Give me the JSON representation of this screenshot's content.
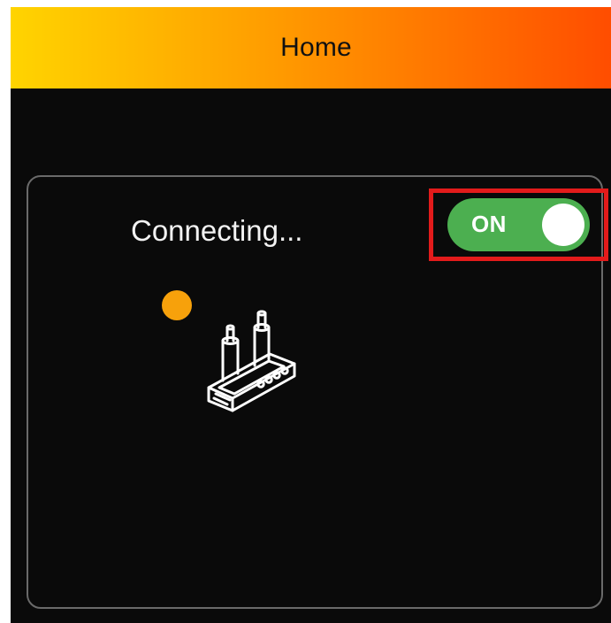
{
  "header": {
    "title": "Home",
    "gradient_start": "#ffd400",
    "gradient_end": "#ff4d00"
  },
  "card": {
    "status_text": "Connecting...",
    "status_dot_color": "#f7a10b",
    "device_icon": "router-icon"
  },
  "toggle": {
    "label": "ON",
    "state": "on",
    "color": "#4caf50",
    "highlight_color": "#e31b1b"
  }
}
